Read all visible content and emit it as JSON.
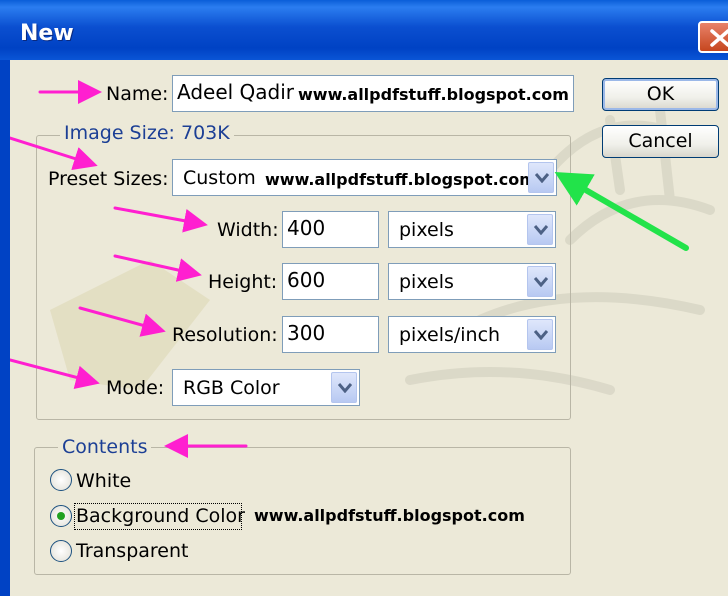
{
  "window": {
    "title": "New"
  },
  "name": {
    "label": "Name:",
    "value": "Adeel Qadir",
    "overlay": "www.allpdfstuff.blogspot.com"
  },
  "buttons": {
    "ok": "OK",
    "cancel": "Cancel"
  },
  "image_size": {
    "group_label": "Image Size: 703K",
    "preset": {
      "label": "Preset Sizes:",
      "value": "Custom",
      "overlay": "www.allpdfstuff.blogspot.com"
    },
    "width": {
      "label": "Width:",
      "value": "400",
      "unit": "pixels"
    },
    "height": {
      "label": "Height:",
      "value": "600",
      "unit": "pixels"
    },
    "resolution": {
      "label": "Resolution:",
      "value": "300",
      "unit": "pixels/inch"
    },
    "mode": {
      "label": "Mode:",
      "value": "RGB Color"
    }
  },
  "contents": {
    "group_label": "Contents",
    "options": [
      "White",
      "Background Color",
      "Transparent"
    ],
    "selected": "Background Color",
    "overlay": "www.allpdfstuff.blogspot.com"
  },
  "colors": {
    "title_bar": "#0042c4",
    "annotation_arrow_magenta": "#ff1fd0",
    "annotation_arrow_green": "#22e34a",
    "group_label": "#1c3f95"
  }
}
